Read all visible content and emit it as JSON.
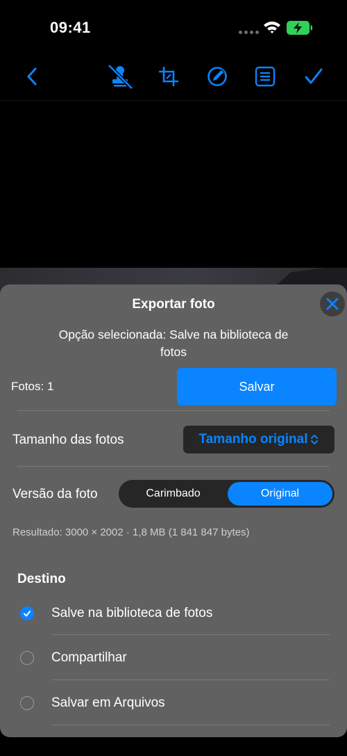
{
  "status": {
    "time": "09:41"
  },
  "sheet": {
    "title": "Exportar foto",
    "subtitle": "Opção selecionada: Salve na biblioteca de fotos",
    "count_label": "Fotos: 1",
    "save_label": "Salvar",
    "size_label": "Tamanho das fotos",
    "size_value": "Tamanho original",
    "version_label": "Versão da foto",
    "version_options": [
      "Carimbado",
      "Original"
    ],
    "version_selected": "Original",
    "result": "Resultado: 3000 × 2002 · 1,8 MB (1 841 847 bytes)",
    "destination_title": "Destino",
    "destinations": [
      {
        "label": "Salve na biblioteca de fotos",
        "selected": true
      },
      {
        "label": "Compartilhar",
        "selected": false
      },
      {
        "label": "Salvar em Arquivos",
        "selected": false
      }
    ]
  },
  "toolbar": {
    "icons": [
      "back-icon",
      "stamp-off-icon",
      "crop-icon",
      "markup-icon",
      "list-icon",
      "done-check-icon"
    ]
  },
  "colors": {
    "accent": "#0a84ff",
    "sheet_bg": "#616161",
    "battery": "#30d158"
  }
}
